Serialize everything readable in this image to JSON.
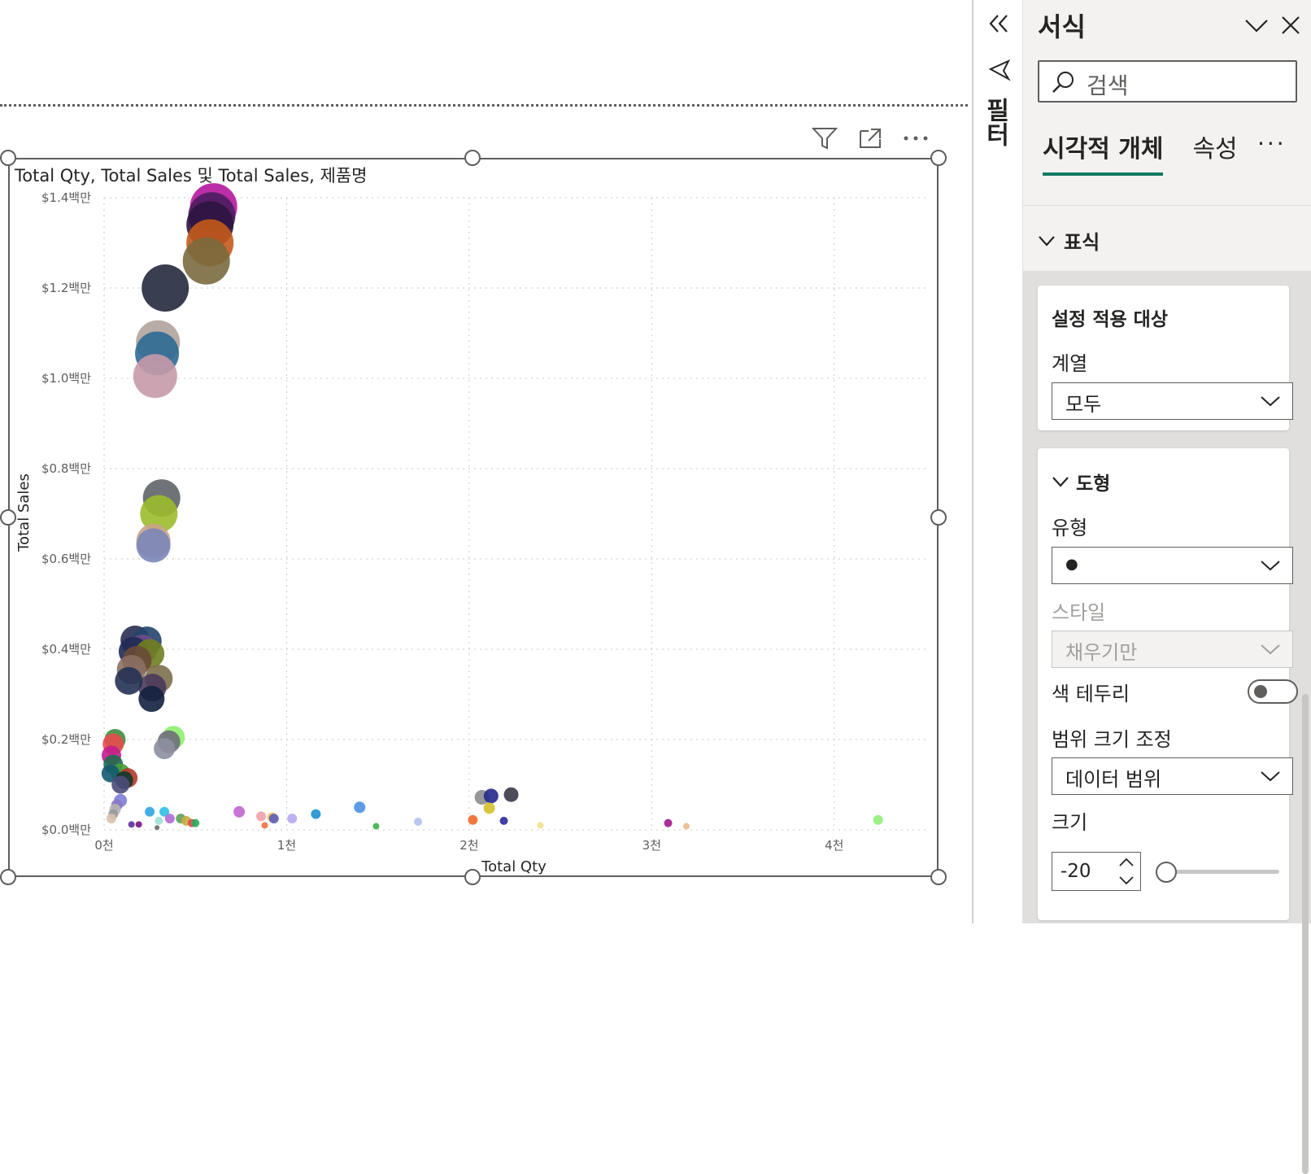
{
  "visual": {
    "title": "Total Qty, Total Sales 및 Total Sales, 제품명",
    "header_icons": [
      "filter-icon",
      "focus-mode-icon",
      "more-options-icon"
    ]
  },
  "chart_data": {
    "type": "scatter",
    "title": "Total Qty, Total Sales 및 Total Sales, 제품명",
    "xlabel": "Total Qty",
    "ylabel": "Total Sales",
    "x_ticks": [
      "0천",
      "1천",
      "2천",
      "3천",
      "4천"
    ],
    "y_ticks": [
      "$0.0백만",
      "$0.2백만",
      "$0.4백만",
      "$0.6백만",
      "$0.8백만",
      "$1.0백만",
      "$1.2백만",
      "$1.4백만"
    ],
    "xlim": [
      0,
      4500
    ],
    "ylim": [
      0,
      1400000
    ],
    "grid": true,
    "points": [
      {
        "x": 600,
        "y": 1380000,
        "size": 29,
        "color": "#b5179e"
      },
      {
        "x": 590,
        "y": 1360000,
        "size": 29,
        "color": "#4a1d5e"
      },
      {
        "x": 580,
        "y": 1340000,
        "size": 29,
        "color": "#2e1440"
      },
      {
        "x": 580,
        "y": 1300000,
        "size": 29,
        "color": "#c45a1a"
      },
      {
        "x": 560,
        "y": 1260000,
        "size": 29,
        "color": "#7a6a3e"
      },
      {
        "x": 335,
        "y": 1200000,
        "size": 29,
        "color": "#24293d"
      },
      {
        "x": 295,
        "y": 1080000,
        "size": 27,
        "color": "#b0a39c"
      },
      {
        "x": 290,
        "y": 1055000,
        "size": 27,
        "color": "#2e6a93"
      },
      {
        "x": 280,
        "y": 1005000,
        "size": 27,
        "color": "#c69aa8"
      },
      {
        "x": 315,
        "y": 735000,
        "size": 23,
        "color": "#5f6468"
      },
      {
        "x": 300,
        "y": 700000,
        "size": 23,
        "color": "#9bbb2c"
      },
      {
        "x": 270,
        "y": 640000,
        "size": 21,
        "color": "#c9a489"
      },
      {
        "x": 270,
        "y": 630000,
        "size": 21,
        "color": "#7a86b8"
      },
      {
        "x": 170,
        "y": 420000,
        "size": 18,
        "color": "#2a2f52"
      },
      {
        "x": 235,
        "y": 418000,
        "size": 18,
        "color": "#22456b"
      },
      {
        "x": 210,
        "y": 400000,
        "size": 18,
        "color": "#6b4b8a"
      },
      {
        "x": 160,
        "y": 395000,
        "size": 18,
        "color": "#1e2a55"
      },
      {
        "x": 250,
        "y": 390000,
        "size": 18,
        "color": "#6f7f1e"
      },
      {
        "x": 180,
        "y": 375000,
        "size": 18,
        "color": "#6a4a3a"
      },
      {
        "x": 150,
        "y": 355000,
        "size": 18,
        "color": "#8c6f63"
      },
      {
        "x": 300,
        "y": 335000,
        "size": 17,
        "color": "#7b6f4a"
      },
      {
        "x": 265,
        "y": 315000,
        "size": 17,
        "color": "#4b3a5c"
      },
      {
        "x": 135,
        "y": 330000,
        "size": 17,
        "color": "#233154"
      },
      {
        "x": 260,
        "y": 290000,
        "size": 16,
        "color": "#13213f"
      },
      {
        "x": 380,
        "y": 205000,
        "size": 14,
        "color": "#8ef06e"
      },
      {
        "x": 355,
        "y": 195000,
        "size": 14,
        "color": "#6e6e7a"
      },
      {
        "x": 330,
        "y": 180000,
        "size": 13,
        "color": "#8d8fa1"
      },
      {
        "x": 60,
        "y": 200000,
        "size": 13,
        "color": "#3e8c3e"
      },
      {
        "x": 50,
        "y": 190000,
        "size": 13,
        "color": "#e84b4b"
      },
      {
        "x": 40,
        "y": 165000,
        "size": 12,
        "color": "#c21d8b"
      },
      {
        "x": 50,
        "y": 145000,
        "size": 12,
        "color": "#1f6b4f"
      },
      {
        "x": 90,
        "y": 125000,
        "size": 12,
        "color": "#4a9c3a"
      },
      {
        "x": 130,
        "y": 115000,
        "size": 12,
        "color": "#b33a2a"
      },
      {
        "x": 35,
        "y": 125000,
        "size": 11,
        "color": "#145a70"
      },
      {
        "x": 110,
        "y": 110000,
        "size": 11,
        "color": "#0f3a2c"
      },
      {
        "x": 90,
        "y": 100000,
        "size": 11,
        "color": "#4b4d7a"
      },
      {
        "x": 90,
        "y": 65000,
        "size": 8,
        "color": "#7f7fd8"
      },
      {
        "x": 70,
        "y": 55000,
        "size": 7,
        "color": "#8c77c4"
      },
      {
        "x": 60,
        "y": 45000,
        "size": 7,
        "color": "#b5b5b5"
      },
      {
        "x": 50,
        "y": 35000,
        "size": 6,
        "color": "#999999"
      },
      {
        "x": 40,
        "y": 25000,
        "size": 6,
        "color": "#d8c2b0"
      },
      {
        "x": 250,
        "y": 40000,
        "size": 6,
        "color": "#2fa6e0"
      },
      {
        "x": 330,
        "y": 40000,
        "size": 6,
        "color": "#2ec0e8"
      },
      {
        "x": 360,
        "y": 25000,
        "size": 6,
        "color": "#b06ad4"
      },
      {
        "x": 420,
        "y": 25000,
        "size": 6,
        "color": "#5aa25a"
      },
      {
        "x": 450,
        "y": 20000,
        "size": 6,
        "color": "#c9ab42"
      },
      {
        "x": 480,
        "y": 15000,
        "size": 5,
        "color": "#e04a4a"
      },
      {
        "x": 500,
        "y": 15000,
        "size": 5,
        "color": "#2aaa5a"
      },
      {
        "x": 150,
        "y": 12000,
        "size": 4,
        "color": "#5b2fa0"
      },
      {
        "x": 190,
        "y": 12000,
        "size": 4,
        "color": "#7a1280"
      },
      {
        "x": 300,
        "y": 20000,
        "size": 5,
        "color": "#9ee0d8"
      },
      {
        "x": 290,
        "y": 5000,
        "size": 3,
        "color": "#6a6a6a"
      },
      {
        "x": 740,
        "y": 40000,
        "size": 7,
        "color": "#c066d0"
      },
      {
        "x": 860,
        "y": 30000,
        "size": 6,
        "color": "#f4a0a8"
      },
      {
        "x": 920,
        "y": 28000,
        "size": 6,
        "color": "#f6c35e"
      },
      {
        "x": 930,
        "y": 25000,
        "size": 6,
        "color": "#5d5db8"
      },
      {
        "x": 880,
        "y": 10000,
        "size": 4,
        "color": "#f07040"
      },
      {
        "x": 1030,
        "y": 25000,
        "size": 6,
        "color": "#b8a8f0"
      },
      {
        "x": 1160,
        "y": 35000,
        "size": 6,
        "color": "#1e90d0"
      },
      {
        "x": 1400,
        "y": 50000,
        "size": 7,
        "color": "#4a90e2"
      },
      {
        "x": 1490,
        "y": 8000,
        "size": 4,
        "color": "#3ab04a"
      },
      {
        "x": 1720,
        "y": 18000,
        "size": 5,
        "color": "#b0c0f0"
      },
      {
        "x": 2070,
        "y": 72000,
        "size": 9,
        "color": "#8c8c8c"
      },
      {
        "x": 2120,
        "y": 75000,
        "size": 9,
        "color": "#23298c"
      },
      {
        "x": 2230,
        "y": 78000,
        "size": 9,
        "color": "#3a3a48"
      },
      {
        "x": 2110,
        "y": 48000,
        "size": 7,
        "color": "#d4c02a"
      },
      {
        "x": 2020,
        "y": 22000,
        "size": 6,
        "color": "#f06a2a"
      },
      {
        "x": 2190,
        "y": 20000,
        "size": 5,
        "color": "#2a2a9a"
      },
      {
        "x": 2390,
        "y": 10000,
        "size": 4,
        "color": "#f0e08a"
      },
      {
        "x": 3090,
        "y": 15000,
        "size": 5,
        "color": "#a01a8a"
      },
      {
        "x": 3190,
        "y": 8000,
        "size": 4,
        "color": "#f0b88a"
      },
      {
        "x": 4240,
        "y": 22000,
        "size": 6,
        "color": "#90f07a"
      }
    ]
  },
  "filter_pane": {
    "label": "필터"
  },
  "format_pane": {
    "title": "서식",
    "search_placeholder": "검색",
    "tabs": [
      "시각적 개체",
      "속성"
    ],
    "more": "···",
    "section_header": "표식",
    "apply_card": {
      "title": "설정 적용 대상",
      "series_label": "계열",
      "series_value": "모두"
    },
    "shape_card": {
      "title": "도형",
      "type_label": "유형",
      "type_value": "●",
      "style_label": "스타일",
      "style_value": "채우기만",
      "border_label": "색 테두리",
      "border_on": false,
      "range_label": "범위 크기 조정",
      "range_value": "데이터 범위",
      "size_label": "크기",
      "size_value": "-20",
      "size_slider_fraction": 0.0
    }
  },
  "colors": {
    "accent": "#117865",
    "border": "#605e5c",
    "pane_bg": "#f3f2f1"
  }
}
